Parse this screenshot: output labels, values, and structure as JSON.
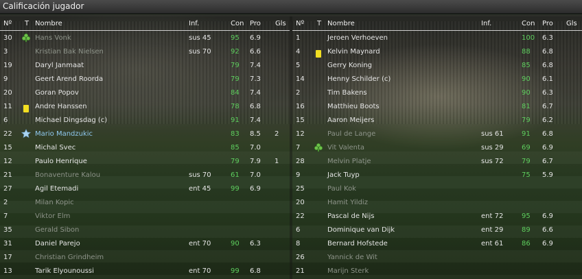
{
  "window": {
    "title": "Calificación jugador"
  },
  "columns": {
    "num": "Nº",
    "t": "T",
    "name": "Nombre",
    "inf": "Inf.",
    "con": "Con",
    "pro": "Pro",
    "gls": "Gls"
  },
  "colors": {
    "con_green": "#5ecf5e",
    "dim_text": "#8e948a",
    "highlight_blue": "#8fc8ee",
    "yellow_card": "#f2de22"
  },
  "left_players": [
    {
      "num": "30",
      "icon": "sub-in-icon",
      "name": "Hans Vonk",
      "inf": "sus 45",
      "con": "95",
      "pro": "6.9",
      "gls": "",
      "style": "dim"
    },
    {
      "num": "3",
      "icon": "",
      "name": "Kristian Bak Nielsen",
      "inf": "sus 70",
      "con": "92",
      "pro": "6.6",
      "gls": "",
      "style": "dim"
    },
    {
      "num": "19",
      "icon": "",
      "name": "Daryl Janmaat",
      "inf": "",
      "con": "79",
      "pro": "7.4",
      "gls": "",
      "style": ""
    },
    {
      "num": "9",
      "icon": "",
      "name": "Geert Arend Roorda",
      "inf": "",
      "con": "79",
      "pro": "7.3",
      "gls": "",
      "style": ""
    },
    {
      "num": "20",
      "icon": "",
      "name": "Goran Popov",
      "inf": "",
      "con": "84",
      "pro": "7.4",
      "gls": "",
      "style": ""
    },
    {
      "num": "11",
      "icon": "yellow-card-icon",
      "name": "Andre Hanssen",
      "inf": "",
      "con": "78",
      "pro": "6.8",
      "gls": "",
      "style": ""
    },
    {
      "num": "6",
      "icon": "",
      "name": "Michael Dingsdag (c)",
      "inf": "",
      "con": "91",
      "pro": "7.4",
      "gls": "",
      "style": ""
    },
    {
      "num": "22",
      "icon": "star-icon",
      "name": "Mario Mandzukic",
      "inf": "",
      "con": "83",
      "pro": "8.5",
      "gls": "2",
      "style": "mom"
    },
    {
      "num": "15",
      "icon": "",
      "name": "Michal Svec",
      "inf": "",
      "con": "85",
      "pro": "7.0",
      "gls": "",
      "style": ""
    },
    {
      "num": "12",
      "icon": "",
      "name": "Paulo Henrique",
      "inf": "",
      "con": "79",
      "pro": "7.9",
      "gls": "1",
      "style": ""
    },
    {
      "num": "21",
      "icon": "",
      "name": "Bonaventure Kalou",
      "inf": "sus 70",
      "con": "61",
      "pro": "7.0",
      "gls": "",
      "style": "dim"
    },
    {
      "num": "27",
      "icon": "",
      "name": "Agil Etemadi",
      "inf": "ent 45",
      "con": "99",
      "pro": "6.9",
      "gls": "",
      "style": ""
    },
    {
      "num": "2",
      "icon": "",
      "name": "Milan Kopic",
      "inf": "",
      "con": "",
      "pro": "",
      "gls": "",
      "style": "dim"
    },
    {
      "num": "7",
      "icon": "",
      "name": "Viktor Elm",
      "inf": "",
      "con": "",
      "pro": "",
      "gls": "",
      "style": "dim"
    },
    {
      "num": "35",
      "icon": "",
      "name": "Gerald Sibon",
      "inf": "",
      "con": "",
      "pro": "",
      "gls": "",
      "style": "dim"
    },
    {
      "num": "31",
      "icon": "",
      "name": "Daniel Parejo",
      "inf": "ent 70",
      "con": "90",
      "pro": "6.3",
      "gls": "",
      "style": ""
    },
    {
      "num": "17",
      "icon": "",
      "name": "Christian Grindheim",
      "inf": "",
      "con": "",
      "pro": "",
      "gls": "",
      "style": "dim"
    },
    {
      "num": "13",
      "icon": "",
      "name": "Tarik Elyounoussi",
      "inf": "ent 70",
      "con": "99",
      "pro": "6.8",
      "gls": "",
      "style": ""
    }
  ],
  "right_players": [
    {
      "num": "1",
      "icon": "",
      "name": "Jeroen Verhoeven",
      "inf": "",
      "con": "100",
      "pro": "6.3",
      "gls": "",
      "style": ""
    },
    {
      "num": "4",
      "icon": "yellow-card-icon",
      "name": "Kelvin Maynard",
      "inf": "",
      "con": "88",
      "pro": "6.8",
      "gls": "",
      "style": ""
    },
    {
      "num": "5",
      "icon": "",
      "name": "Gerry Koning",
      "inf": "",
      "con": "85",
      "pro": "6.8",
      "gls": "",
      "style": ""
    },
    {
      "num": "14",
      "icon": "",
      "name": "Henny Schilder (c)",
      "inf": "",
      "con": "90",
      "pro": "6.1",
      "gls": "",
      "style": ""
    },
    {
      "num": "2",
      "icon": "",
      "name": "Tim Bakens",
      "inf": "",
      "con": "90",
      "pro": "6.3",
      "gls": "",
      "style": ""
    },
    {
      "num": "16",
      "icon": "",
      "name": "Matthieu Boots",
      "inf": "",
      "con": "81",
      "pro": "6.7",
      "gls": "",
      "style": ""
    },
    {
      "num": "15",
      "icon": "",
      "name": "Aaron Meijers",
      "inf": "",
      "con": "79",
      "pro": "6.2",
      "gls": "",
      "style": ""
    },
    {
      "num": "12",
      "icon": "",
      "name": "Paul de Lange",
      "inf": "sus 61",
      "con": "91",
      "pro": "6.8",
      "gls": "",
      "style": "dim"
    },
    {
      "num": "7",
      "icon": "sub-in-icon",
      "name": "Vit Valenta",
      "inf": "sus 29",
      "con": "69",
      "pro": "6.9",
      "gls": "",
      "style": "dim"
    },
    {
      "num": "28",
      "icon": "",
      "name": "Melvin Platje",
      "inf": "sus 72",
      "con": "79",
      "pro": "6.7",
      "gls": "",
      "style": "dim"
    },
    {
      "num": "9",
      "icon": "",
      "name": "Jack Tuyp",
      "inf": "",
      "con": "75",
      "pro": "5.9",
      "gls": "",
      "style": ""
    },
    {
      "num": "25",
      "icon": "",
      "name": "Paul Kok",
      "inf": "",
      "con": "",
      "pro": "",
      "gls": "",
      "style": "dim"
    },
    {
      "num": "20",
      "icon": "",
      "name": "Hamit Yildiz",
      "inf": "",
      "con": "",
      "pro": "",
      "gls": "",
      "style": "dim"
    },
    {
      "num": "22",
      "icon": "",
      "name": "Pascal de Nijs",
      "inf": "ent 72",
      "con": "95",
      "pro": "6.9",
      "gls": "",
      "style": ""
    },
    {
      "num": "6",
      "icon": "",
      "name": "Dominique van Dijk",
      "inf": "ent 29",
      "con": "89",
      "pro": "6.6",
      "gls": "",
      "style": ""
    },
    {
      "num": "8",
      "icon": "",
      "name": "Bernard Hofstede",
      "inf": "ent 61",
      "con": "86",
      "pro": "6.9",
      "gls": "",
      "style": ""
    },
    {
      "num": "26",
      "icon": "",
      "name": "Yannick de Wit",
      "inf": "",
      "con": "",
      "pro": "",
      "gls": "",
      "style": "dim"
    },
    {
      "num": "21",
      "icon": "",
      "name": "Marijn Sterk",
      "inf": "",
      "con": "",
      "pro": "",
      "gls": "",
      "style": "dim"
    }
  ]
}
